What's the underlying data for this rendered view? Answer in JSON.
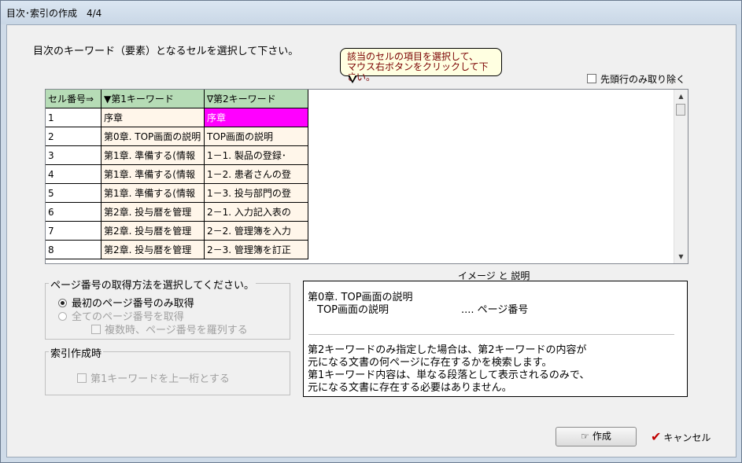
{
  "window": {
    "title": "目次･索引の作成　4/4"
  },
  "instruction": "目次のキーワード（要素）となるセルを選択して下さい。",
  "tooltip": {
    "line1": "該当のセルの項目を選択して、",
    "line2": "マウス右ボタンをクリックして下さい。"
  },
  "option_first_row": {
    "label": "先頭行のみ取り除く",
    "checked": false
  },
  "grid": {
    "headers": [
      "セル番号⇒",
      "▼第1キーワード",
      "∇第2キーワード"
    ],
    "rows": [
      {
        "num": "1",
        "kw1": "序章",
        "kw2": "序章"
      },
      {
        "num": "2",
        "kw1": "第0章. TOP画面の説明",
        "kw2": "TOP画面の説明"
      },
      {
        "num": "3",
        "kw1": "第1章. 準備する(情報",
        "kw2": "1－1. 製品の登録･"
      },
      {
        "num": "4",
        "kw1": "第1章. 準備する(情報",
        "kw2": "1－2. 患者さんの登"
      },
      {
        "num": "5",
        "kw1": "第1章. 準備する(情報",
        "kw2": "1－3. 投与部門の登"
      },
      {
        "num": "6",
        "kw1": "第2章. 投与暦を管理",
        "kw2": "2－1. 入力記入表の"
      },
      {
        "num": "7",
        "kw1": "第2章. 投与暦を管理",
        "kw2": "2－2. 管理簿を入力"
      },
      {
        "num": "8",
        "kw1": "第2章. 投与暦を管理",
        "kw2": "2－3. 管理簿を訂正"
      }
    ]
  },
  "page_number_group": {
    "title": "ページ番号の取得方法を選択してください。",
    "option_first_only": "最初のページ番号のみ取得",
    "option_all": "全てのページ番号を取得",
    "option_multi": "複数時、ページ番号を羅列する"
  },
  "index_group": {
    "title": "索引作成時",
    "option_upper": "第1キーワードを上一桁とする"
  },
  "description": {
    "title": "イメージ と 説明",
    "example_line1": "第0章. TOP画面の説明",
    "example_line2": "TOP画面の説明",
    "example_page": ".... ページ番号",
    "text": [
      "第2キーワードのみ指定した場合は、第2キーワードの内容が",
      "元になる文書の何ページに存在するかを検索します。",
      "第1キーワード内容は、単なる段落として表示されるのみで、",
      "元になる文書に存在する必要はありません。"
    ]
  },
  "buttons": {
    "create": "作成",
    "cancel": "キャンセル"
  }
}
